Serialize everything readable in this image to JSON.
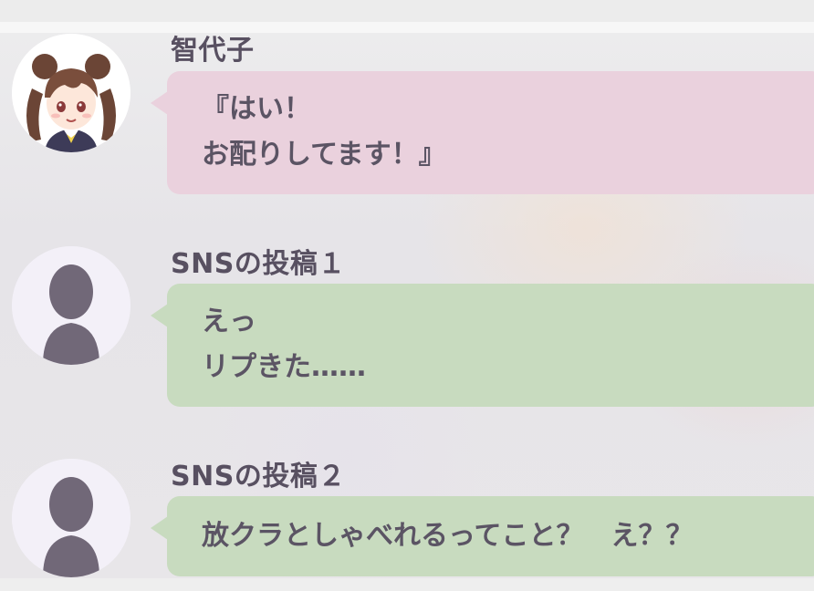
{
  "messages": [
    {
      "sender": "智代子",
      "avatar_icon": "chiyoko-character-icon",
      "bubble_color": "#ead1dd",
      "lines": [
        "『はい！",
        "お配りしてます！』"
      ]
    },
    {
      "sender": "SNSの投稿１",
      "avatar_icon": "anonymous-user-silhouette-icon",
      "bubble_color": "#c8dbbf",
      "lines": [
        "えっ",
        "リプきた……"
      ]
    },
    {
      "sender": "SNSの投稿２",
      "avatar_icon": "anonymous-user-silhouette-icon",
      "bubble_color": "#c8dbbf",
      "lines": [
        "放クラとしゃべれるってこと？　え？？"
      ]
    }
  ]
}
